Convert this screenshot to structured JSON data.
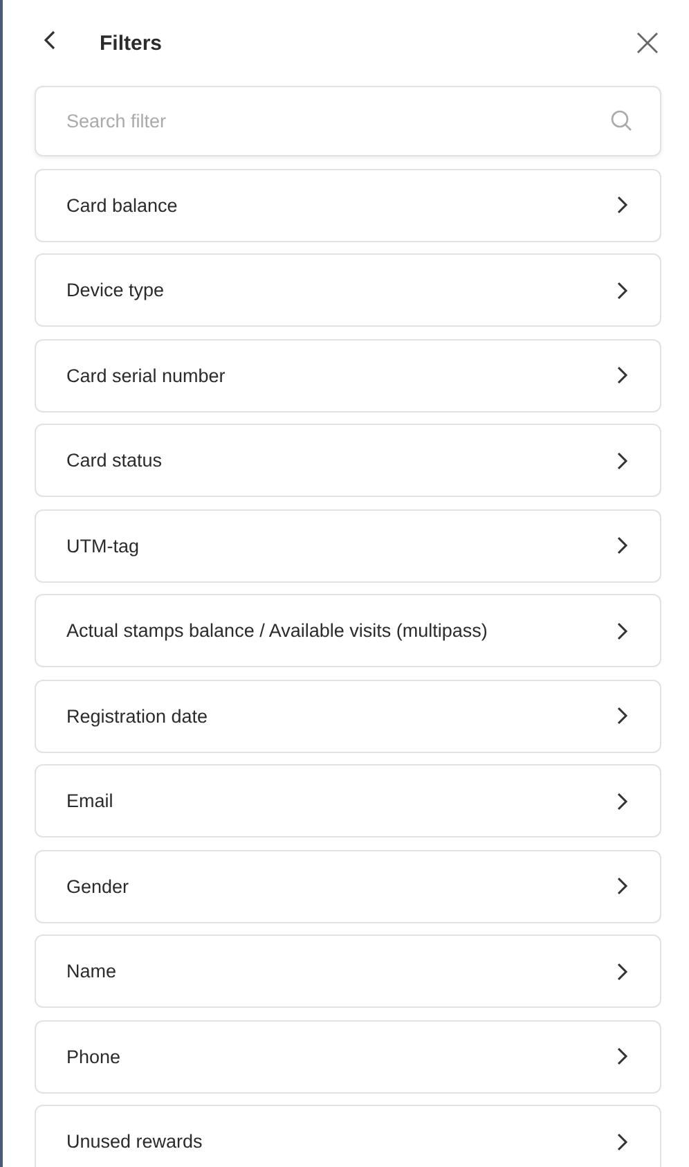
{
  "header": {
    "title": "Filters"
  },
  "search": {
    "placeholder": "Search filter"
  },
  "filters": [
    {
      "label": "Card balance"
    },
    {
      "label": "Device type"
    },
    {
      "label": "Card serial number"
    },
    {
      "label": "Card status"
    },
    {
      "label": "UTM-tag"
    },
    {
      "label": "Actual stamps balance / Available visits (multipass)"
    },
    {
      "label": "Registration date"
    },
    {
      "label": "Email"
    },
    {
      "label": "Gender"
    },
    {
      "label": "Name"
    },
    {
      "label": "Phone"
    },
    {
      "label": "Unused rewards"
    }
  ]
}
